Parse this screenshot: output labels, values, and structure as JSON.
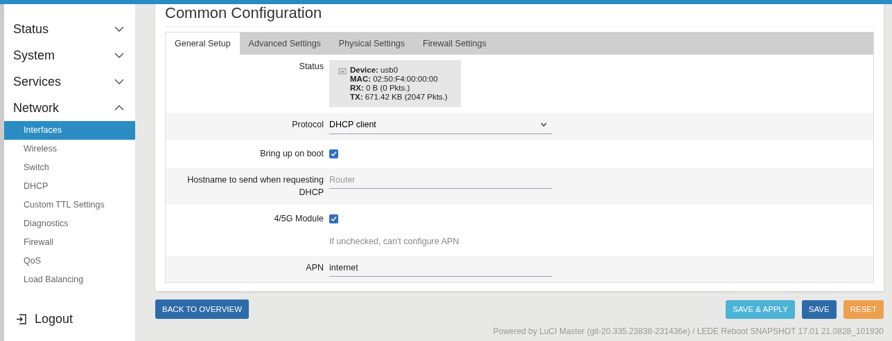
{
  "sidebar": {
    "groups": [
      {
        "label": "Status",
        "expanded": false
      },
      {
        "label": "System",
        "expanded": false
      },
      {
        "label": "Services",
        "expanded": false
      },
      {
        "label": "Network",
        "expanded": true,
        "items": [
          {
            "label": "Interfaces",
            "selected": true
          },
          {
            "label": "Wireless",
            "selected": false
          },
          {
            "label": "Switch",
            "selected": false
          },
          {
            "label": "DHCP",
            "selected": false
          },
          {
            "label": "Custom TTL Settings",
            "selected": false
          },
          {
            "label": "Diagnostics",
            "selected": false
          },
          {
            "label": "Firewall",
            "selected": false
          },
          {
            "label": "QoS",
            "selected": false
          },
          {
            "label": "Load Balancing",
            "selected": false
          }
        ]
      }
    ],
    "logout": "Logout"
  },
  "section": {
    "title": "Common Configuration",
    "tabs": [
      {
        "label": "General Setup",
        "selected": true
      },
      {
        "label": "Advanced Settings",
        "selected": false
      },
      {
        "label": "Physical Settings",
        "selected": false
      },
      {
        "label": "Firewall Settings",
        "selected": false
      }
    ],
    "fields": [
      {
        "kind": "status",
        "label": "Status",
        "lines": [
          "**Device:** usb0",
          "**MAC:** 02:50:F4:00:00:00",
          "**RX:** 0 B (0 Pkts.)",
          "**TX:** 671.42 KB (2047 Pkts.)"
        ]
      },
      {
        "kind": "select",
        "label": "Protocol",
        "value": "DHCP client"
      },
      {
        "kind": "checkbox",
        "label": "Bring up on boot",
        "checked": true
      },
      {
        "kind": "text",
        "label": "Hostname to send when requesting DHCP",
        "placeholder": "Router"
      },
      {
        "kind": "checkbox",
        "label": "4/5G Module",
        "checked": true,
        "hint": "If unchecked, can't configure APN"
      },
      {
        "kind": "text",
        "label": "APN",
        "value": "internet"
      }
    ]
  },
  "buttons": {
    "back": "BACK TO OVERVIEW",
    "actions": [
      {
        "label": "SAVE & APPLY",
        "kind": "apply"
      },
      {
        "label": "SAVE",
        "kind": "save"
      },
      {
        "label": "RESET",
        "kind": "reset"
      }
    ]
  },
  "footer": "Powered by LuCI Master (git-20.335.23838-231436e) / LEDE Reboot SNAPSHOT 17.01 21.0828_101930"
}
